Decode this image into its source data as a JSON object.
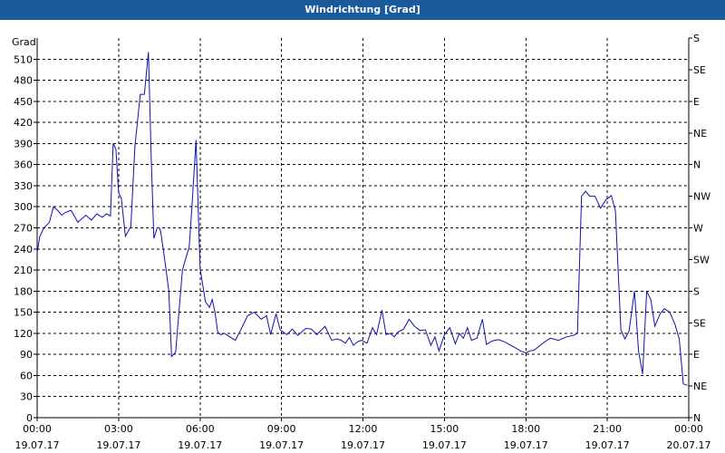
{
  "window": {
    "title": "Windrichtung [Grad]"
  },
  "chart_data": {
    "type": "line",
    "title": "Windrichtung [Grad]",
    "ylabel": "Grad",
    "xlabel": "",
    "ylim": [
      0,
      540
    ],
    "xlim_hours": [
      0,
      24
    ],
    "grid": true,
    "line_color": "#1010b0",
    "y_ticks": [
      0,
      30,
      60,
      90,
      120,
      150,
      180,
      210,
      240,
      270,
      300,
      330,
      360,
      390,
      420,
      450,
      480,
      510
    ],
    "x_ticks": [
      {
        "time": "00:00",
        "date": "19.07.17",
        "hour": 0
      },
      {
        "time": "03:00",
        "date": "19.07.17",
        "hour": 3
      },
      {
        "time": "06:00",
        "date": "19.07.17",
        "hour": 6
      },
      {
        "time": "09:00",
        "date": "19.07.17",
        "hour": 9
      },
      {
        "time": "12:00",
        "date": "19.07.17",
        "hour": 12
      },
      {
        "time": "15:00",
        "date": "19.07.17",
        "hour": 15
      },
      {
        "time": "18:00",
        "date": "19.07.17",
        "hour": 18
      },
      {
        "time": "21:00",
        "date": "19.07.17",
        "hour": 21
      },
      {
        "time": "00:00",
        "date": "20.07.17",
        "hour": 24
      }
    ],
    "right_axis": [
      {
        "label": "S",
        "value": 540
      },
      {
        "label": "SE",
        "value": 495
      },
      {
        "label": "E",
        "value": 450
      },
      {
        "label": "NE",
        "value": 405
      },
      {
        "label": "N",
        "value": 360
      },
      {
        "label": "NW",
        "value": 315
      },
      {
        "label": "W",
        "value": 270
      },
      {
        "label": "SW",
        "value": 225
      },
      {
        "label": "S",
        "value": 180
      },
      {
        "label": "SE",
        "value": 135
      },
      {
        "label": "E",
        "value": 90
      },
      {
        "label": "NE",
        "value": 45
      },
      {
        "label": "N",
        "value": 0
      }
    ],
    "series": [
      {
        "x_hours": [
          0.0,
          0.1,
          0.25,
          0.45,
          0.6,
          0.75,
          0.9,
          1.05,
          1.25,
          1.5,
          1.65,
          1.8,
          2.0,
          2.2,
          2.4,
          2.55,
          2.7,
          2.8,
          2.9,
          3.0,
          3.1,
          3.25,
          3.45,
          3.6,
          3.8,
          3.95,
          4.1,
          4.2,
          4.3,
          4.42,
          4.5,
          4.55,
          4.65,
          4.75,
          4.85,
          4.95,
          5.1,
          5.35,
          5.5,
          5.6,
          5.7,
          5.85,
          6.0,
          6.2,
          6.35,
          6.45,
          6.55,
          6.65,
          6.75,
          6.9,
          7.1,
          7.3,
          7.5,
          7.75,
          8.0,
          8.25,
          8.45,
          8.6,
          8.8,
          8.95,
          9.2,
          9.4,
          9.6,
          9.75,
          9.9,
          10.1,
          10.3,
          10.6,
          10.85,
          11.05,
          11.2,
          11.35,
          11.5,
          11.65,
          11.8,
          11.95,
          12.15,
          12.35,
          12.5,
          12.7,
          12.85,
          13.0,
          13.15,
          13.3,
          13.5,
          13.7,
          13.9,
          14.1,
          14.3,
          14.5,
          14.65,
          14.8,
          15.0,
          15.2,
          15.4,
          15.55,
          15.7,
          15.85,
          16.0,
          16.2,
          16.4,
          16.55,
          16.7,
          16.85,
          17.0,
          17.2,
          17.5,
          17.8,
          18.0,
          18.15,
          18.3,
          18.5,
          18.7,
          18.9,
          19.2,
          19.5,
          19.75,
          19.9,
          20.05,
          20.2,
          20.35,
          20.55,
          20.75,
          20.95,
          21.15,
          21.3,
          21.5,
          21.65,
          21.8,
          22.0,
          22.15,
          22.3,
          22.45,
          22.6,
          22.75,
          22.95,
          23.1,
          23.3,
          23.5,
          23.65,
          23.8,
          23.95
        ],
        "values": [
          235,
          258,
          270,
          278,
          300,
          295,
          288,
          292,
          295,
          278,
          283,
          288,
          281,
          290,
          285,
          290,
          287,
          390,
          382,
          320,
          312,
          258,
          272,
          385,
          460,
          460,
          520,
          372,
          255,
          270,
          270,
          265,
          238,
          210,
          180,
          87,
          93,
          210,
          230,
          243,
          300,
          395,
          212,
          165,
          157,
          168,
          150,
          122,
          118,
          120,
          115,
          110,
          125,
          145,
          150,
          140,
          145,
          118,
          148,
          125,
          118,
          126,
          117,
          122,
          127,
          126,
          118,
          130,
          110,
          112,
          110,
          106,
          114,
          103,
          108,
          110,
          106,
          128,
          118,
          153,
          118,
          120,
          115,
          122,
          126,
          140,
          130,
          124,
          125,
          103,
          115,
          95,
          118,
          128,
          105,
          120,
          113,
          128,
          110,
          113,
          140,
          104,
          108,
          110,
          111,
          108,
          102,
          95,
          92,
          95,
          96,
          102,
          108,
          113,
          110,
          115,
          117,
          120,
          315,
          322,
          315,
          315,
          298,
          310,
          316,
          294,
          125,
          112,
          123,
          180,
          95,
          62,
          180,
          168,
          130,
          148,
          155,
          150,
          132,
          112,
          48,
          46
        ]
      }
    ]
  }
}
